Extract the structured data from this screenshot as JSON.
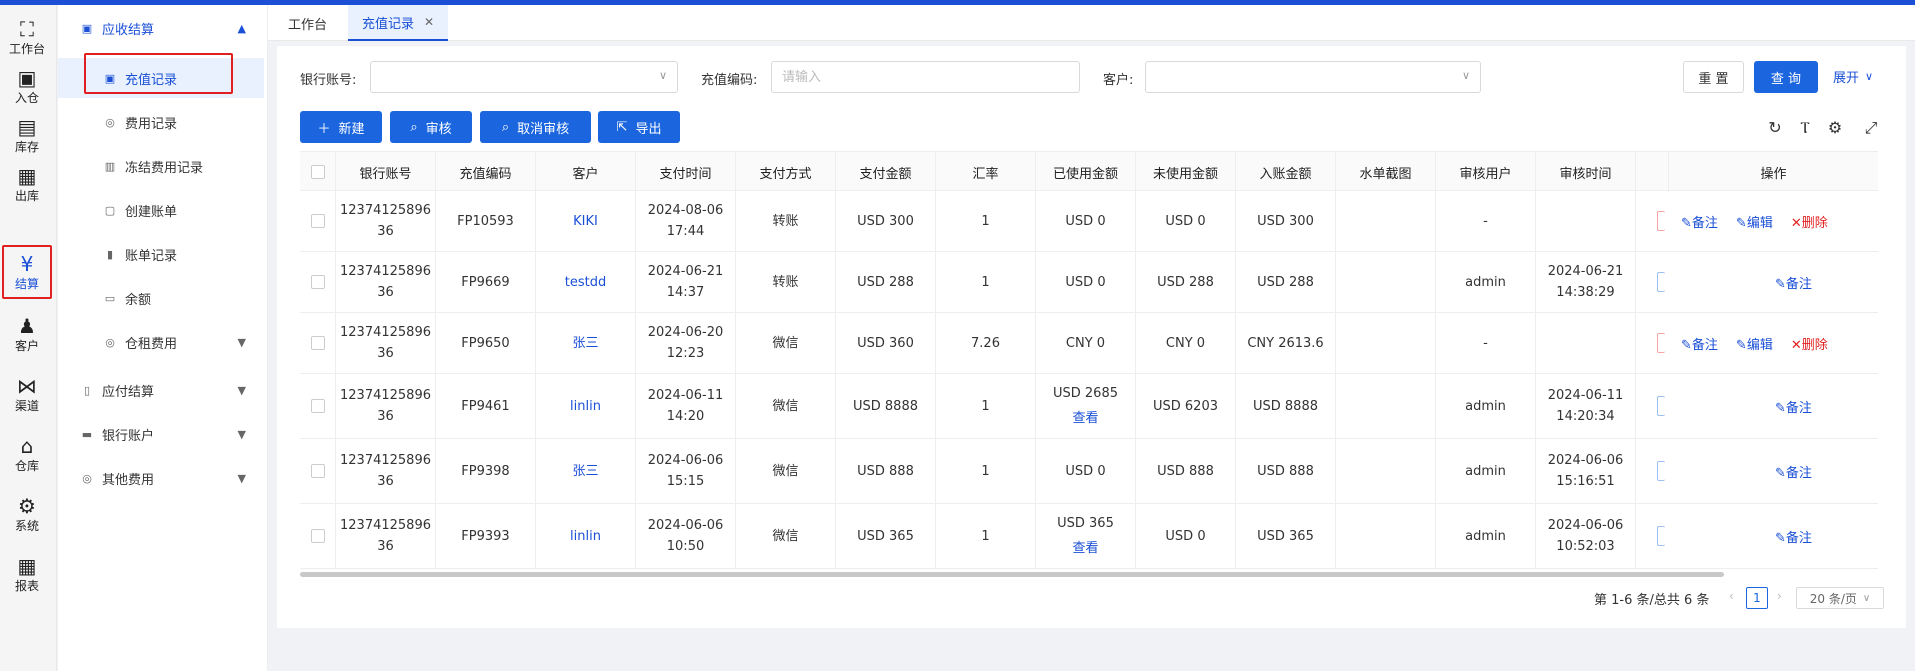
{
  "rail": {
    "items": [
      {
        "label": "工作台",
        "icon": "workbench-icon",
        "glyph": "⛶"
      },
      {
        "label": "入仓",
        "icon": "inbound-icon",
        "glyph": "▣"
      },
      {
        "label": "库存",
        "icon": "inventory-icon",
        "glyph": "▤"
      },
      {
        "label": "出库",
        "icon": "outbound-icon",
        "glyph": "▦"
      },
      {
        "label": "结算",
        "icon": "settlement-icon",
        "glyph": "¥"
      },
      {
        "label": "客户",
        "icon": "customer-icon",
        "glyph": "♟"
      },
      {
        "label": "渠道",
        "icon": "channel-icon",
        "glyph": "⋈"
      },
      {
        "label": "仓库",
        "icon": "warehouse-icon",
        "glyph": "⌂"
      },
      {
        "label": "系统",
        "icon": "system-gear-icon",
        "glyph": "⚙"
      },
      {
        "label": "报表",
        "icon": "report-icon",
        "glyph": "▦"
      }
    ]
  },
  "submenu": {
    "receivable": "应收结算",
    "recharge": "充值记录",
    "fee_records": "费用记录",
    "frozen_fee": "冻结费用记录",
    "create_bill": "创建账单",
    "bill_records": "账单记录",
    "balance": "余额",
    "storage_fee": "仓租费用",
    "payable": "应付结算",
    "bank_account": "银行账户",
    "other_fee": "其他费用"
  },
  "tabs": {
    "workbench": "工作台",
    "recharge": "充值记录",
    "close": "✕"
  },
  "filters": {
    "bank_account_label": "银行账号:",
    "recharge_code_label": "充值编码:",
    "recharge_code_placeholder": "请输入",
    "customer_label": "客户:",
    "reset": "重 置",
    "search": "查 询",
    "expand": "展开"
  },
  "toolbar": {
    "new": "新建",
    "audit": "审核",
    "cancel_audit": "取消审核",
    "export": "导出"
  },
  "table": {
    "headers": {
      "account": "银行账号",
      "code": "充值编码",
      "customer": "客户",
      "time": "支付时间",
      "method": "支付方式",
      "amount": "支付金额",
      "rate": "汇率",
      "used": "已使用金额",
      "unused": "未使用金额",
      "credited": "入账金额",
      "receipt": "水单截图",
      "auditor": "审核用户",
      "audit_time": "审核时间",
      "actions": "操作"
    },
    "rows": [
      {
        "account1": "12374125896",
        "account2": "36",
        "code": "FP10593",
        "customer": "KIKI",
        "date": "2024-08-06",
        "time": "17:44",
        "method": "转账",
        "amount": "USD 300",
        "rate": "1",
        "used": "USD 0",
        "view": "",
        "unused": "USD 0",
        "credited": "USD 300",
        "receipt": "",
        "auditor": "-",
        "audit_date": "",
        "audit_time": "",
        "note": "备注",
        "edit": "编辑",
        "delete": "删除"
      },
      {
        "account1": "12374125896",
        "account2": "36",
        "code": "FP9669",
        "customer": "testdd",
        "date": "2024-06-21",
        "time": "14:37",
        "method": "转账",
        "amount": "USD 288",
        "rate": "1",
        "used": "USD 0",
        "view": "",
        "unused": "USD 288",
        "credited": "USD 288",
        "receipt": "",
        "auditor": "admin",
        "audit_date": "2024-06-21",
        "audit_time": "14:38:29",
        "note": "备注",
        "edit": "",
        "delete": ""
      },
      {
        "account1": "12374125896",
        "account2": "36",
        "code": "FP9650",
        "customer": "张三",
        "date": "2024-06-20",
        "time": "12:23",
        "method": "微信",
        "amount": "USD 360",
        "rate": "7.26",
        "used": "CNY 0",
        "view": "",
        "unused": "CNY 0",
        "credited": "CNY 2613.6",
        "receipt": "",
        "auditor": "-",
        "audit_date": "",
        "audit_time": "",
        "note": "备注",
        "edit": "编辑",
        "delete": "删除"
      },
      {
        "account1": "12374125896",
        "account2": "36",
        "code": "FP9461",
        "customer": "linlin",
        "date": "2024-06-11",
        "time": "14:20",
        "method": "微信",
        "amount": "USD 8888",
        "rate": "1",
        "used": "USD 2685",
        "view": "查看",
        "unused": "USD 6203",
        "credited": "USD 8888",
        "receipt": "",
        "auditor": "admin",
        "audit_date": "2024-06-11",
        "audit_time": "14:20:34",
        "note": "备注",
        "edit": "",
        "delete": ""
      },
      {
        "account1": "12374125896",
        "account2": "36",
        "code": "FP9398",
        "customer": "张三",
        "date": "2024-06-06",
        "time": "15:15",
        "method": "微信",
        "amount": "USD 888",
        "rate": "1",
        "used": "USD 0",
        "view": "",
        "unused": "USD 888",
        "credited": "USD 888",
        "receipt": "",
        "auditor": "admin",
        "audit_date": "2024-06-06",
        "audit_time": "15:16:51",
        "note": "备注",
        "edit": "",
        "delete": ""
      },
      {
        "account1": "12374125896",
        "account2": "36",
        "code": "FP9393",
        "customer": "linlin",
        "date": "2024-06-06",
        "time": "10:50",
        "method": "微信",
        "amount": "USD 365",
        "rate": "1",
        "used": "USD 365",
        "view": "查看",
        "unused": "USD 0",
        "credited": "USD 365",
        "receipt": "",
        "auditor": "admin",
        "audit_date": "2024-06-06",
        "audit_time": "10:52:03",
        "note": "备注",
        "edit": "",
        "delete": ""
      }
    ]
  },
  "pagination": {
    "summary": "第 1-6 条/总共 6 条",
    "current_page": "1",
    "page_size": "20 条/页"
  },
  "colors": {
    "accent": "#1b66df",
    "danger": "#e02020",
    "top_bar": "#1a4fd6"
  }
}
